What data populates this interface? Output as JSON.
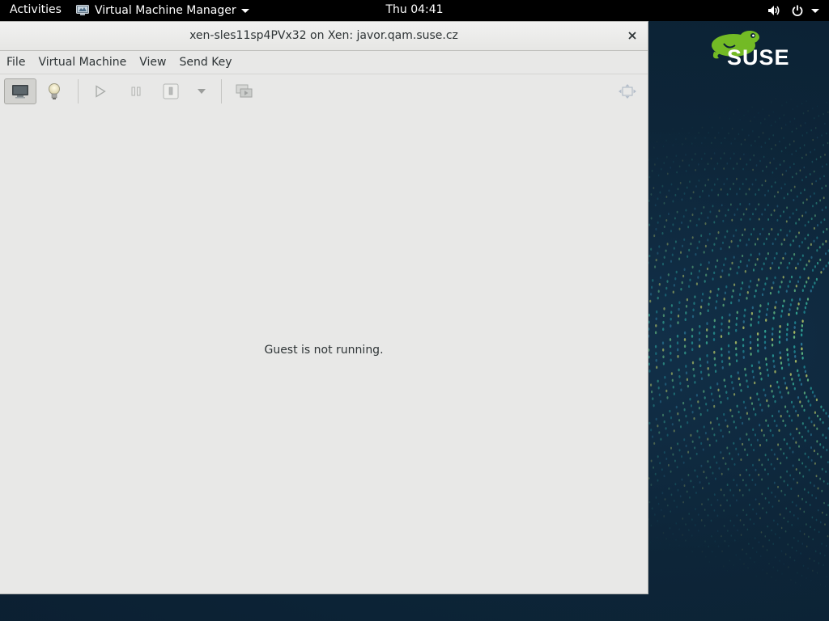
{
  "topbar": {
    "activities_label": "Activities",
    "app_menu_label": "Virtual Machine Manager",
    "clock": "Thu 04:41"
  },
  "window": {
    "title": "xen-sles11sp4PVx32 on Xen: javor.qam.suse.cz",
    "menu": [
      {
        "label": "File"
      },
      {
        "label": "Virtual Machine"
      },
      {
        "label": "View"
      },
      {
        "label": "Send Key"
      }
    ],
    "toolbar": [
      {
        "name": "console-button",
        "icon": "monitor-icon",
        "active": true,
        "enabled": true
      },
      {
        "name": "details-button",
        "icon": "lightbulb-icon",
        "active": false,
        "enabled": true
      },
      {
        "name": "run-button",
        "icon": "play-icon",
        "active": false,
        "enabled": false
      },
      {
        "name": "pause-button",
        "icon": "pause-icon",
        "active": false,
        "enabled": false
      },
      {
        "name": "shutdown-button",
        "icon": "power-off-icon",
        "active": false,
        "enabled": false
      },
      {
        "name": "shutdown-menu-button",
        "icon": "chevron-down-icon",
        "active": false,
        "enabled": false
      },
      {
        "name": "snapshots-button",
        "icon": "snapshots-icon",
        "active": false,
        "enabled": false
      },
      {
        "name": "fullscreen-button",
        "icon": "fullscreen-icon",
        "active": false,
        "enabled": false
      }
    ],
    "status_message": "Guest is not running."
  },
  "desktop": {
    "brand": "SUSE",
    "brand_color": "#73ba25"
  }
}
